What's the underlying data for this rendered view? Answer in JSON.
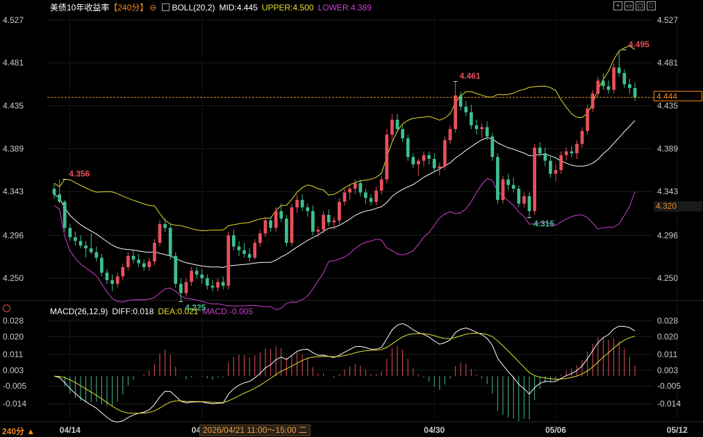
{
  "header": {
    "symbol": "美债10年收益率",
    "period": "【240分】",
    "boll_label": "BOLL(20,2)",
    "mid": "MID:4.445",
    "upper": "UPPER:4.500",
    "lower": "LOWER:4.389"
  },
  "macd_header": {
    "label": "MACD(26,12,9)",
    "diff": "DIFF:0.018",
    "dea": "DEA:0.021",
    "macd": "MACD:-0.005"
  },
  "toolbar_icons": [
    "crosshair-icon",
    "expand-icon",
    "window-icon",
    "maximize-icon"
  ],
  "last_price_tag": "4.444",
  "cursor_price_tag": "4.320",
  "timeframe": "240分",
  "cursor_time": "2026/04/21 11:00～15:00 二",
  "colors": {
    "up": "#e8505b",
    "down": "#3fbf8f",
    "mid": "#ffffff",
    "upper": "#e6e22e",
    "lower": "#d040d0",
    "diff": "#ffffff",
    "dea": "#e6e22e",
    "accent": "#f08a20",
    "grid": "#1c1c1c"
  },
  "chart_data": {
    "type": "candlestick",
    "y_ticks": [
      "4.527",
      "4.481",
      "4.435",
      "4.389",
      "4.343",
      "4.296",
      "4.250"
    ],
    "ylim": [
      4.23,
      4.535
    ],
    "x_ticks": [
      "04/14",
      "04/18",
      "04/30",
      "05/06",
      "05/12"
    ],
    "candles": [
      {
        "o": 4.346,
        "h": 4.352,
        "l": 4.335,
        "c": 4.34
      },
      {
        "o": 4.34,
        "h": 4.356,
        "l": 4.33,
        "c": 4.332
      },
      {
        "o": 4.332,
        "h": 4.334,
        "l": 4.3,
        "c": 4.304
      },
      {
        "o": 4.304,
        "h": 4.308,
        "l": 4.29,
        "c": 4.294
      },
      {
        "o": 4.294,
        "h": 4.3,
        "l": 4.285,
        "c": 4.29
      },
      {
        "o": 4.29,
        "h": 4.296,
        "l": 4.282,
        "c": 4.285
      },
      {
        "o": 4.285,
        "h": 4.29,
        "l": 4.272,
        "c": 4.282
      },
      {
        "o": 4.282,
        "h": 4.298,
        "l": 4.276,
        "c": 4.278
      },
      {
        "o": 4.278,
        "h": 4.284,
        "l": 4.268,
        "c": 4.272
      },
      {
        "o": 4.272,
        "h": 4.276,
        "l": 4.252,
        "c": 4.256
      },
      {
        "o": 4.256,
        "h": 4.26,
        "l": 4.244,
        "c": 4.248
      },
      {
        "o": 4.248,
        "h": 4.254,
        "l": 4.236,
        "c": 4.244
      },
      {
        "o": 4.244,
        "h": 4.256,
        "l": 4.24,
        "c": 4.252
      },
      {
        "o": 4.252,
        "h": 4.266,
        "l": 4.248,
        "c": 4.262
      },
      {
        "o": 4.262,
        "h": 4.278,
        "l": 4.258,
        "c": 4.274
      },
      {
        "o": 4.274,
        "h": 4.28,
        "l": 4.266,
        "c": 4.27
      },
      {
        "o": 4.27,
        "h": 4.276,
        "l": 4.262,
        "c": 4.266
      },
      {
        "o": 4.266,
        "h": 4.27,
        "l": 4.258,
        "c": 4.262
      },
      {
        "o": 4.262,
        "h": 4.272,
        "l": 4.258,
        "c": 4.268
      },
      {
        "o": 4.268,
        "h": 4.292,
        "l": 4.264,
        "c": 4.288
      },
      {
        "o": 4.288,
        "h": 4.312,
        "l": 4.284,
        "c": 4.308
      },
      {
        "o": 4.308,
        "h": 4.314,
        "l": 4.3,
        "c": 4.304
      },
      {
        "o": 4.304,
        "h": 4.308,
        "l": 4.27,
        "c": 4.274
      },
      {
        "o": 4.274,
        "h": 4.278,
        "l": 4.24,
        "c": 4.244
      },
      {
        "o": 4.244,
        "h": 4.25,
        "l": 4.225,
        "c": 4.234
      },
      {
        "o": 4.234,
        "h": 4.25,
        "l": 4.23,
        "c": 4.246
      },
      {
        "o": 4.246,
        "h": 4.262,
        "l": 4.242,
        "c": 4.258
      },
      {
        "o": 4.258,
        "h": 4.262,
        "l": 4.25,
        "c": 4.254
      },
      {
        "o": 4.254,
        "h": 4.26,
        "l": 4.244,
        "c": 4.25
      },
      {
        "o": 4.25,
        "h": 4.254,
        "l": 4.238,
        "c": 4.242
      },
      {
        "o": 4.242,
        "h": 4.248,
        "l": 4.236,
        "c": 4.24
      },
      {
        "o": 4.24,
        "h": 4.25,
        "l": 4.236,
        "c": 4.246
      },
      {
        "o": 4.246,
        "h": 4.252,
        "l": 4.238,
        "c": 4.242
      },
      {
        "o": 4.242,
        "h": 4.3,
        "l": 4.238,
        "c": 4.296
      },
      {
        "o": 4.296,
        "h": 4.302,
        "l": 4.28,
        "c": 4.284
      },
      {
        "o": 4.284,
        "h": 4.29,
        "l": 4.274,
        "c": 4.28
      },
      {
        "o": 4.28,
        "h": 4.288,
        "l": 4.272,
        "c": 4.276
      },
      {
        "o": 4.276,
        "h": 4.282,
        "l": 4.268,
        "c": 4.272
      },
      {
        "o": 4.272,
        "h": 4.292,
        "l": 4.27,
        "c": 4.288
      },
      {
        "o": 4.288,
        "h": 4.302,
        "l": 4.284,
        "c": 4.298
      },
      {
        "o": 4.298,
        "h": 4.316,
        "l": 4.294,
        "c": 4.312
      },
      {
        "o": 4.312,
        "h": 4.316,
        "l": 4.3,
        "c": 4.304
      },
      {
        "o": 4.304,
        "h": 4.326,
        "l": 4.3,
        "c": 4.322
      },
      {
        "o": 4.322,
        "h": 4.33,
        "l": 4.31,
        "c": 4.314
      },
      {
        "o": 4.314,
        "h": 4.318,
        "l": 4.284,
        "c": 4.288
      },
      {
        "o": 4.288,
        "h": 4.33,
        "l": 4.284,
        "c": 4.326
      },
      {
        "o": 4.326,
        "h": 4.34,
        "l": 4.32,
        "c": 4.334
      },
      {
        "o": 4.334,
        "h": 4.34,
        "l": 4.322,
        "c": 4.326
      },
      {
        "o": 4.326,
        "h": 4.33,
        "l": 4.316,
        "c": 4.322
      },
      {
        "o": 4.322,
        "h": 4.328,
        "l": 4.296,
        "c": 4.3
      },
      {
        "o": 4.3,
        "h": 4.306,
        "l": 4.294,
        "c": 4.302
      },
      {
        "o": 4.302,
        "h": 4.322,
        "l": 4.298,
        "c": 4.318
      },
      {
        "o": 4.318,
        "h": 4.324,
        "l": 4.306,
        "c": 4.31
      },
      {
        "o": 4.31,
        "h": 4.316,
        "l": 4.302,
        "c": 4.312
      },
      {
        "o": 4.312,
        "h": 4.336,
        "l": 4.308,
        "c": 4.332
      },
      {
        "o": 4.332,
        "h": 4.346,
        "l": 4.328,
        "c": 4.342
      },
      {
        "o": 4.342,
        "h": 4.35,
        "l": 4.334,
        "c": 4.346
      },
      {
        "o": 4.346,
        "h": 4.356,
        "l": 4.34,
        "c": 4.352
      },
      {
        "o": 4.352,
        "h": 4.356,
        "l": 4.338,
        "c": 4.342
      },
      {
        "o": 4.342,
        "h": 4.346,
        "l": 4.33,
        "c": 4.336
      },
      {
        "o": 4.336,
        "h": 4.34,
        "l": 4.328,
        "c": 4.332
      },
      {
        "o": 4.332,
        "h": 4.348,
        "l": 4.328,
        "c": 4.344
      },
      {
        "o": 4.344,
        "h": 4.36,
        "l": 4.34,
        "c": 4.356
      },
      {
        "o": 4.356,
        "h": 4.41,
        "l": 4.352,
        "c": 4.404
      },
      {
        "o": 4.404,
        "h": 4.426,
        "l": 4.398,
        "c": 4.42
      },
      {
        "o": 4.42,
        "h": 4.426,
        "l": 4.406,
        "c": 4.41
      },
      {
        "o": 4.41,
        "h": 4.414,
        "l": 4.396,
        "c": 4.4
      },
      {
        "o": 4.4,
        "h": 4.404,
        "l": 4.376,
        "c": 4.38
      },
      {
        "o": 4.38,
        "h": 4.384,
        "l": 4.368,
        "c": 4.372
      },
      {
        "o": 4.372,
        "h": 4.378,
        "l": 4.36,
        "c": 4.376
      },
      {
        "o": 4.376,
        "h": 4.386,
        "l": 4.37,
        "c": 4.382
      },
      {
        "o": 4.382,
        "h": 4.386,
        "l": 4.372,
        "c": 4.378
      },
      {
        "o": 4.378,
        "h": 4.384,
        "l": 4.364,
        "c": 4.368
      },
      {
        "o": 4.368,
        "h": 4.374,
        "l": 4.36,
        "c": 4.37
      },
      {
        "o": 4.37,
        "h": 4.402,
        "l": 4.366,
        "c": 4.398
      },
      {
        "o": 4.398,
        "h": 4.414,
        "l": 4.394,
        "c": 4.41
      },
      {
        "o": 4.41,
        "h": 4.461,
        "l": 4.406,
        "c": 4.446
      },
      {
        "o": 4.446,
        "h": 4.45,
        "l": 4.43,
        "c": 4.434
      },
      {
        "o": 4.434,
        "h": 4.44,
        "l": 4.424,
        "c": 4.428
      },
      {
        "o": 4.428,
        "h": 4.436,
        "l": 4.41,
        "c": 4.414
      },
      {
        "o": 4.414,
        "h": 4.42,
        "l": 4.404,
        "c": 4.41
      },
      {
        "o": 4.41,
        "h": 4.416,
        "l": 4.4,
        "c": 4.412
      },
      {
        "o": 4.412,
        "h": 4.418,
        "l": 4.398,
        "c": 4.402
      },
      {
        "o": 4.402,
        "h": 4.406,
        "l": 4.376,
        "c": 4.38
      },
      {
        "o": 4.38,
        "h": 4.384,
        "l": 4.33,
        "c": 4.334
      },
      {
        "o": 4.334,
        "h": 4.36,
        "l": 4.33,
        "c": 4.356
      },
      {
        "o": 4.356,
        "h": 4.362,
        "l": 4.344,
        "c": 4.35
      },
      {
        "o": 4.35,
        "h": 4.358,
        "l": 4.342,
        "c": 4.346
      },
      {
        "o": 4.346,
        "h": 4.35,
        "l": 4.326,
        "c": 4.33
      },
      {
        "o": 4.33,
        "h": 4.342,
        "l": 4.326,
        "c": 4.338
      },
      {
        "o": 4.338,
        "h": 4.342,
        "l": 4.315,
        "c": 4.322
      },
      {
        "o": 4.322,
        "h": 4.394,
        "l": 4.318,
        "c": 4.39
      },
      {
        "o": 4.39,
        "h": 4.396,
        "l": 4.38,
        "c": 4.384
      },
      {
        "o": 4.384,
        "h": 4.39,
        "l": 4.37,
        "c": 4.376
      },
      {
        "o": 4.376,
        "h": 4.38,
        "l": 4.358,
        "c": 4.362
      },
      {
        "o": 4.362,
        "h": 4.372,
        "l": 4.354,
        "c": 4.366
      },
      {
        "o": 4.366,
        "h": 4.386,
        "l": 4.362,
        "c": 4.382
      },
      {
        "o": 4.382,
        "h": 4.39,
        "l": 4.376,
        "c": 4.386
      },
      {
        "o": 4.386,
        "h": 4.392,
        "l": 4.38,
        "c": 4.384
      },
      {
        "o": 4.384,
        "h": 4.398,
        "l": 4.378,
        "c": 4.394
      },
      {
        "o": 4.394,
        "h": 4.412,
        "l": 4.39,
        "c": 4.408
      },
      {
        "o": 4.408,
        "h": 4.436,
        "l": 4.404,
        "c": 4.432
      },
      {
        "o": 4.432,
        "h": 4.452,
        "l": 4.428,
        "c": 4.448
      },
      {
        "o": 4.448,
        "h": 4.466,
        "l": 4.444,
        "c": 4.462
      },
      {
        "o": 4.462,
        "h": 4.47,
        "l": 4.452,
        "c": 4.456
      },
      {
        "o": 4.456,
        "h": 4.462,
        "l": 4.448,
        "c": 4.452
      },
      {
        "o": 4.452,
        "h": 4.48,
        "l": 4.448,
        "c": 4.476
      },
      {
        "o": 4.476,
        "h": 4.495,
        "l": 4.466,
        "c": 4.47
      },
      {
        "o": 4.47,
        "h": 4.474,
        "l": 4.454,
        "c": 4.458
      },
      {
        "o": 4.458,
        "h": 4.464,
        "l": 4.448,
        "c": 4.454
      },
      {
        "o": 4.454,
        "h": 4.46,
        "l": 4.44,
        "c": 4.444
      }
    ],
    "annotations": [
      {
        "label": "4.356",
        "value": 4.356,
        "index": 2,
        "kind": "high"
      },
      {
        "label": "4.225",
        "value": 4.225,
        "index": 24,
        "kind": "low"
      },
      {
        "label": "4.461",
        "value": 4.461,
        "index": 76,
        "kind": "high"
      },
      {
        "label": "4.315",
        "value": 4.315,
        "index": 90,
        "kind": "low"
      },
      {
        "label": "4.495",
        "value": 4.495,
        "index": 108,
        "kind": "high"
      }
    ],
    "last_price": 4.444,
    "macd": {
      "y_ticks": [
        "0.028",
        "0.020",
        "0.011",
        "0.003",
        "-0.005",
        "-0.014"
      ],
      "ylim": [
        -0.022,
        0.031
      ]
    },
    "x_tick_index": [
      3,
      28,
      72,
      95,
      118
    ]
  }
}
